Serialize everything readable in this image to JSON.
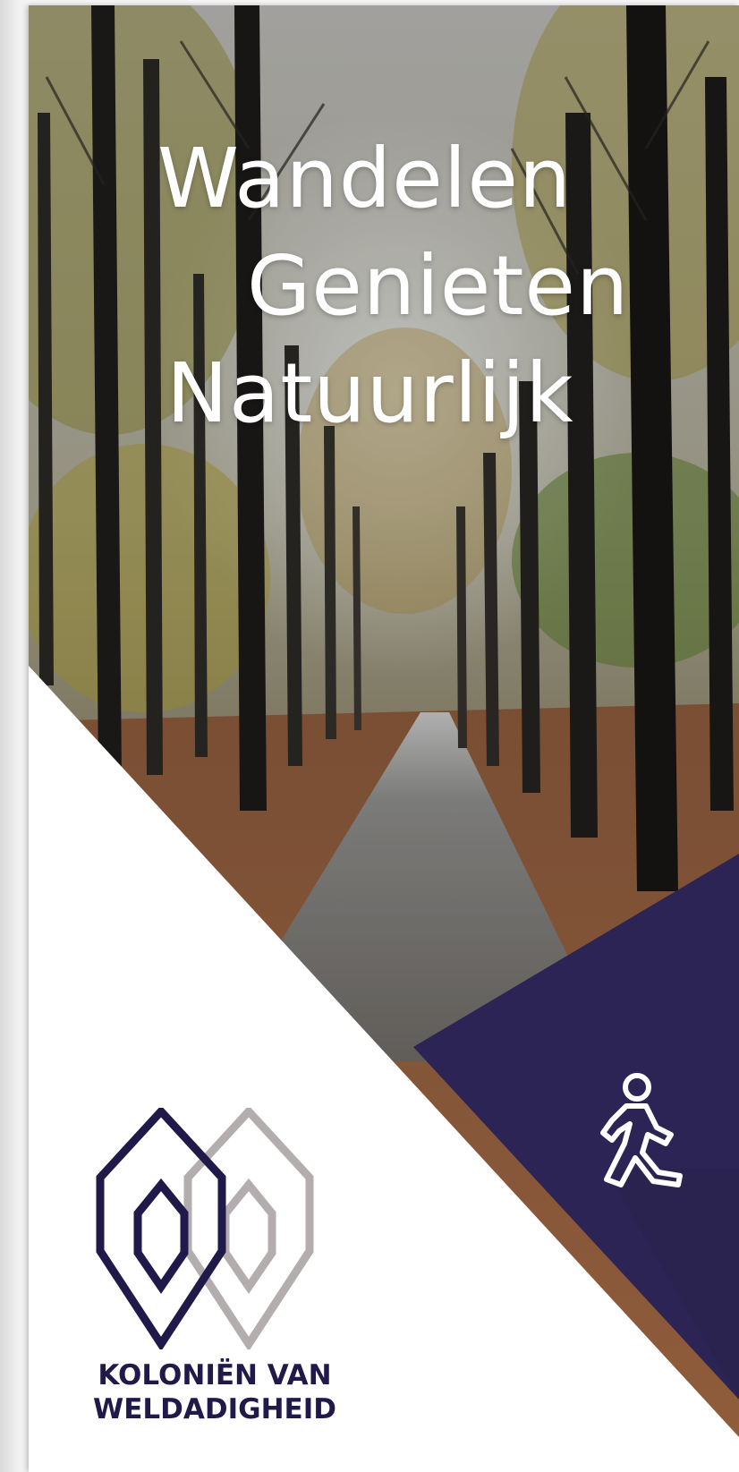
{
  "document": {
    "headline": {
      "line1": "Wandelen",
      "line2": "Genieten",
      "line3": "Natuurlijk"
    },
    "brand": {
      "name_line1": "KOLONIËN VAN",
      "name_line2": "WELDADIGHEID",
      "logo_icon": "koloniën-van-weldadigheid-logo",
      "primary_color": "#201a4a",
      "secondary_color": "#b3adad"
    },
    "icons": {
      "activity": "walking-person-icon"
    },
    "colors": {
      "accent_triangle": "#2c2454",
      "page_background": "#ffffff"
    }
  }
}
